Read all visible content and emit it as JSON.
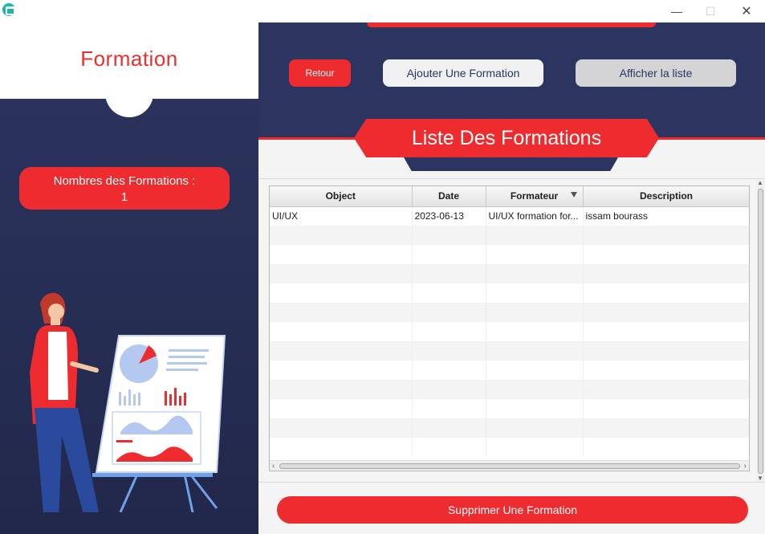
{
  "window": {
    "minimize_icon": "—",
    "maximize_icon": "☐",
    "close_icon": "✕"
  },
  "sidebar": {
    "title": "Formation",
    "count_label": "Nombres des Formations :",
    "count_value": "1"
  },
  "toolbar": {
    "back_label": "Retour",
    "add_label": "Ajouter Une Formation",
    "list_label": "Afficher la liste"
  },
  "banner": {
    "title": "Liste Des Formations"
  },
  "table": {
    "columns": [
      "Object",
      "Date",
      "Formateur",
      "Description"
    ],
    "rows": [
      [
        "UI/UX",
        "2023-06-13",
        "UI/UX formation for...",
        "issam bourass"
      ]
    ]
  },
  "footer": {
    "delete_label": "Supprimer Une Formation"
  },
  "colors": {
    "accent_red": "#ee2b2e",
    "navy": "#2c3560"
  }
}
